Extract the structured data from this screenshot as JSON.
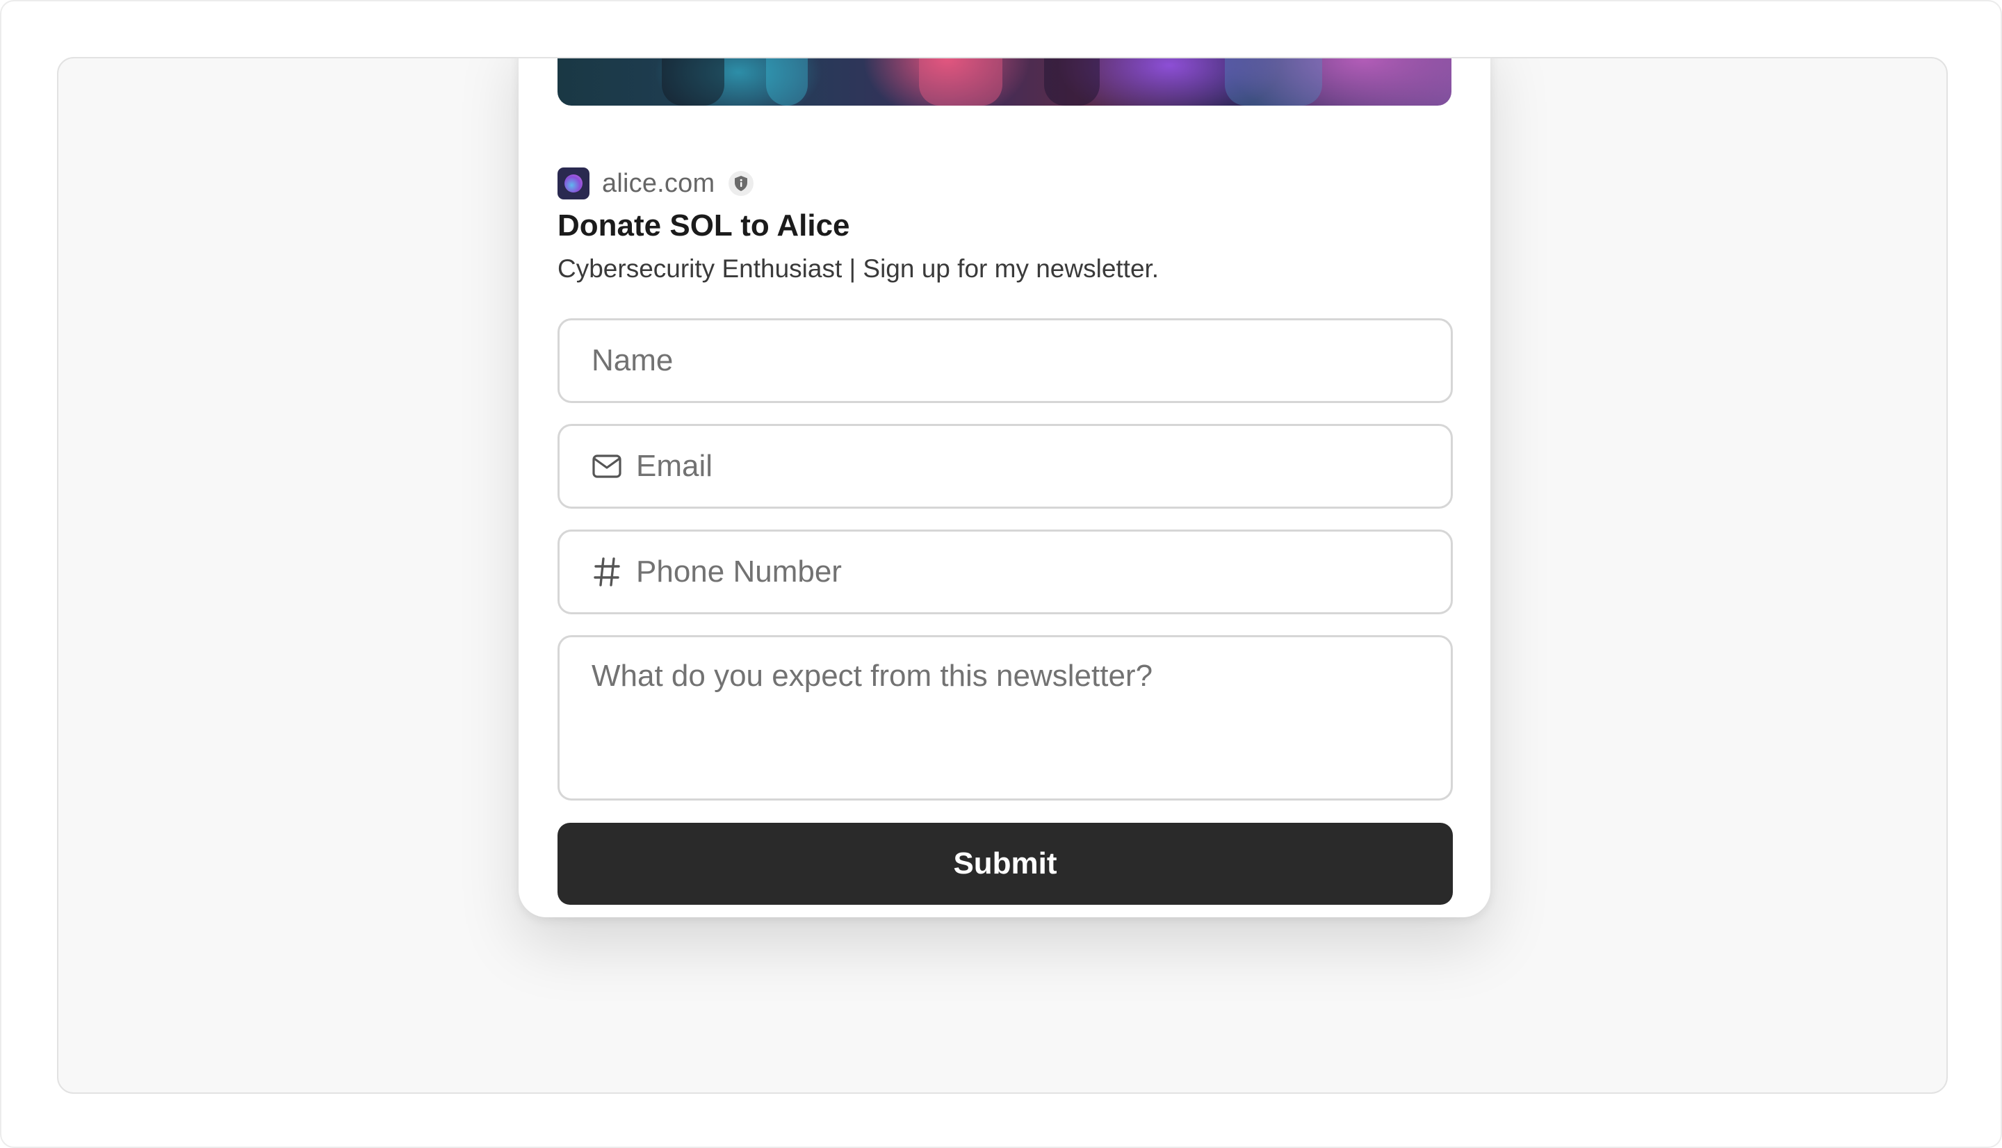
{
  "site": {
    "domain": "alice.com",
    "logo_icon": "site-logo-icon",
    "verified_icon": "shield-icon"
  },
  "card": {
    "title": "Donate SOL to Alice",
    "subtitle": "Cybersecurity Enthusiast | Sign up for my newsletter."
  },
  "form": {
    "name_placeholder": "Name",
    "email_placeholder": "Email",
    "email_icon": "mail-icon",
    "phone_placeholder": "Phone Number",
    "phone_icon": "hash-icon",
    "message_placeholder": "What do you expect from this newsletter?",
    "submit_label": "Submit"
  },
  "colors": {
    "button_bg": "#2a2a2a",
    "button_text": "#ffffff",
    "border": "#d6d6d6",
    "stage_bg": "#f8f8f8"
  }
}
